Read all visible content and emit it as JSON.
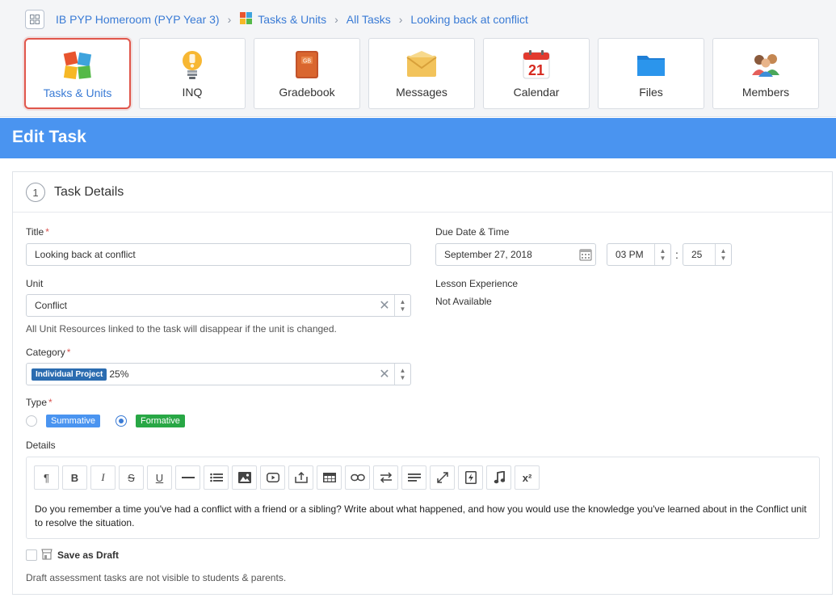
{
  "breadcrumb": {
    "course": "IB PYP Homeroom (PYP Year 3)",
    "section": "Tasks & Units",
    "list": "All Tasks",
    "current": "Looking back at conflict"
  },
  "tiles": [
    {
      "label": "Tasks & Units",
      "icon": "puzzle-icon"
    },
    {
      "label": "INQ",
      "icon": "lightbulb-icon"
    },
    {
      "label": "Gradebook",
      "icon": "gradebook-icon"
    },
    {
      "label": "Messages",
      "icon": "envelope-icon"
    },
    {
      "label": "Calendar",
      "icon": "calendar-icon"
    },
    {
      "label": "Files",
      "icon": "folder-icon"
    },
    {
      "label": "Members",
      "icon": "members-icon"
    }
  ],
  "calendar_tile_day": "21",
  "gradebook_tile_mark": "GB",
  "page": {
    "title": "Edit Task"
  },
  "section": {
    "number": "1",
    "title": "Task Details"
  },
  "form": {
    "title_label": "Title",
    "title_value": "Looking back at conflict",
    "unit_label": "Unit",
    "unit_value": "Conflict",
    "unit_help": "All Unit Resources linked to the task will disappear if the unit is changed.",
    "category_label": "Category",
    "category_badge": "Individual Project",
    "category_weight": "25%",
    "type_label": "Type",
    "type_options": [
      {
        "label": "Summative",
        "color": "#4a94f0",
        "selected": false
      },
      {
        "label": "Formative",
        "color": "#28a745",
        "selected": true
      }
    ],
    "details_label": "Details",
    "details_text": "Do you remember a time you've had a conflict with a friend or a sibling? Write about what happened, and how you would use the knowledge you've learned about in the Conflict unit to resolve the situation.",
    "due_label": "Due Date & Time",
    "due_date": "September 27, 2018",
    "due_hour": "03 PM",
    "time_sep": ":",
    "due_minute": "25",
    "lesson_label": "Lesson Experience",
    "lesson_value": "Not Available",
    "draft_label": "Save as Draft",
    "draft_checked": false,
    "draft_help": "Draft assessment tasks are not visible to students & parents."
  },
  "toolbar": [
    "paragraph-icon",
    "bold-icon",
    "italic-icon",
    "strikethrough-icon",
    "underline-icon",
    "horizontal-rule-icon",
    "list-icon",
    "image-icon",
    "video-icon",
    "upload-icon",
    "table-icon",
    "link-icon",
    "swap-icon",
    "align-icon",
    "fullscreen-icon",
    "lightning-icon",
    "music-icon",
    "superscript-icon"
  ],
  "toolbar_glyphs": {
    "paragraph": "¶",
    "bold": "B",
    "italic": "I",
    "strike": "S",
    "underline": "U",
    "superscript": "x²"
  },
  "colors": {
    "accent": "#4a94f0",
    "link": "#3a7bd5",
    "active_tile_border": "#e0564b",
    "required": "#d9534f"
  }
}
